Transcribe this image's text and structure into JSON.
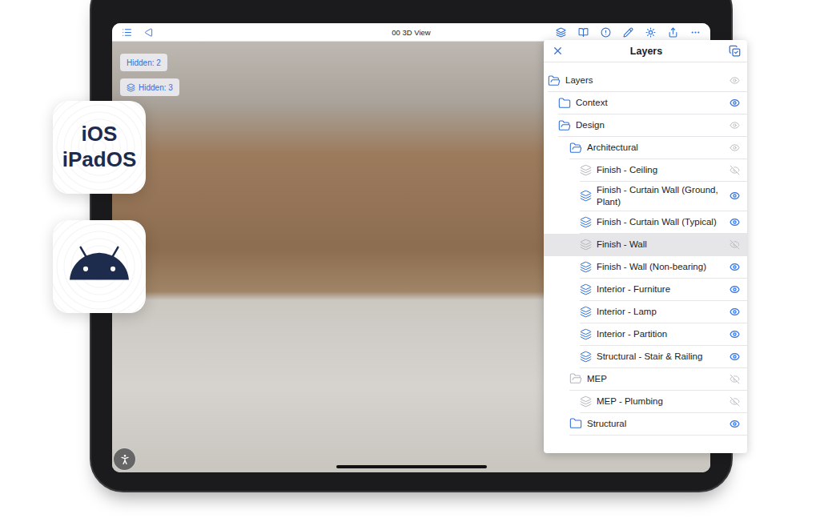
{
  "badges": [
    {
      "kind": "text",
      "lines": [
        "iOS",
        "iPadOS"
      ]
    },
    {
      "kind": "android",
      "lines": []
    }
  ],
  "toolbar": {
    "title": "00 3D View"
  },
  "hidden_chips": [
    {
      "label": "Hidden: 2",
      "kind": "objects"
    },
    {
      "label": "Hidden: 3",
      "kind": "layers"
    }
  ],
  "layers_panel": {
    "title": "Layers",
    "tree": [
      {
        "label": "Layers",
        "kind": "root",
        "expanded": true,
        "visible": true,
        "mixed": true,
        "selected": false,
        "children": [
          {
            "label": "Context",
            "kind": "folder",
            "expanded": false,
            "visible": true,
            "mixed": false,
            "selected": false,
            "children": []
          },
          {
            "label": "Design",
            "kind": "folder",
            "expanded": true,
            "visible": true,
            "mixed": true,
            "selected": false,
            "children": [
              {
                "label": "Architectural",
                "kind": "folder",
                "expanded": true,
                "visible": true,
                "mixed": true,
                "selected": false,
                "children": [
                  {
                    "label": "Finish - Ceiling",
                    "kind": "layer",
                    "expanded": false,
                    "visible": false,
                    "mixed": false,
                    "selected": false,
                    "children": []
                  },
                  {
                    "label": "Finish - Curtain Wall (Ground, Plant)",
                    "kind": "layer",
                    "expanded": false,
                    "visible": true,
                    "mixed": false,
                    "selected": false,
                    "children": []
                  },
                  {
                    "label": "Finish - Curtain Wall (Typical)",
                    "kind": "layer",
                    "expanded": false,
                    "visible": true,
                    "mixed": false,
                    "selected": false,
                    "children": []
                  },
                  {
                    "label": "Finish - Wall",
                    "kind": "layer",
                    "expanded": false,
                    "visible": false,
                    "mixed": false,
                    "selected": true,
                    "children": []
                  },
                  {
                    "label": "Finish - Wall (Non-bearing)",
                    "kind": "layer",
                    "expanded": false,
                    "visible": true,
                    "mixed": false,
                    "selected": false,
                    "children": []
                  },
                  {
                    "label": "Interior - Furniture",
                    "kind": "layer",
                    "expanded": false,
                    "visible": true,
                    "mixed": false,
                    "selected": false,
                    "children": []
                  },
                  {
                    "label": "Interior - Lamp",
                    "kind": "layer",
                    "expanded": false,
                    "visible": true,
                    "mixed": false,
                    "selected": false,
                    "children": []
                  },
                  {
                    "label": "Interior - Partition",
                    "kind": "layer",
                    "expanded": false,
                    "visible": true,
                    "mixed": false,
                    "selected": false,
                    "children": []
                  },
                  {
                    "label": "Structural - Stair & Railing",
                    "kind": "layer",
                    "expanded": false,
                    "visible": true,
                    "mixed": false,
                    "selected": false,
                    "children": []
                  }
                ]
              },
              {
                "label": "MEP",
                "kind": "folder",
                "expanded": true,
                "visible": false,
                "mixed": false,
                "selected": false,
                "children": [
                  {
                    "label": "MEP - Plumbing",
                    "kind": "layer",
                    "expanded": false,
                    "visible": false,
                    "mixed": false,
                    "selected": false,
                    "children": []
                  }
                ]
              },
              {
                "label": "Structural",
                "kind": "folder",
                "expanded": false,
                "visible": true,
                "mixed": false,
                "selected": false,
                "children": []
              }
            ]
          }
        ]
      }
    ]
  }
}
